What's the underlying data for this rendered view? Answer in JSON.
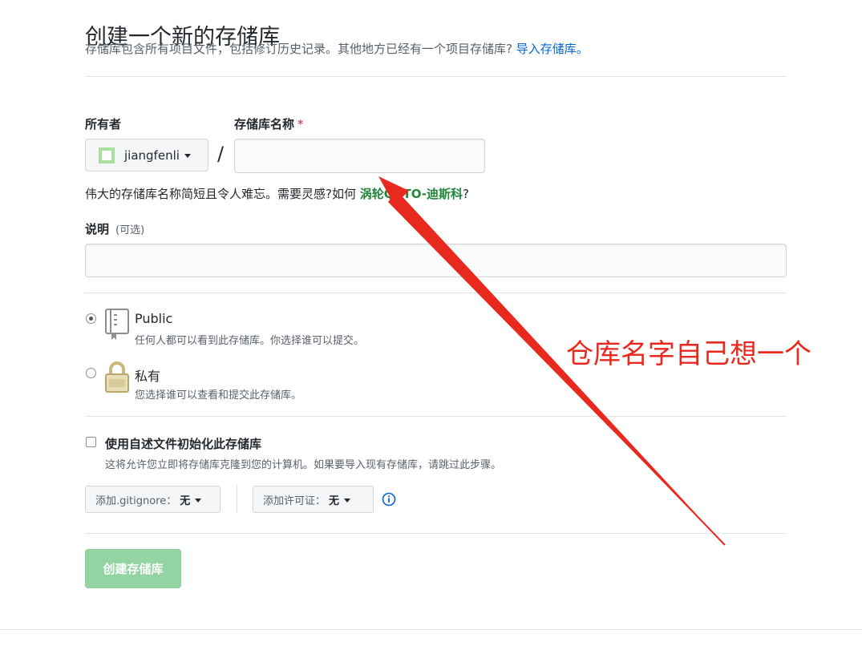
{
  "header": {
    "title": "创建一个新的存储库",
    "subtitle": "存储库包含所有项目文件，包括修订历史记录。其他地方已经有一个项目存储库?",
    "import_link": "导入存储库。"
  },
  "form": {
    "owner_label": "所有者",
    "owner_value": "jiangfenli",
    "slash": "/",
    "name_label": "存储库名称",
    "required_mark": "*",
    "name_value": "",
    "hint_prefix": "伟大的存储库名称简短且令人难忘。需要灵感?如何",
    "hint_suggestion": "涡轮OCTO-迪斯科",
    "hint_suffix": "?",
    "description_label": "说明",
    "description_optional": "(可选)",
    "description_value": ""
  },
  "visibility": {
    "public": {
      "title": "Public",
      "desc": "任何人都可以看到此存储库。你选择谁可以提交。",
      "checked": true
    },
    "private": {
      "title": "私有",
      "desc": "您选择谁可以查看和提交此存储库。",
      "checked": false
    }
  },
  "init": {
    "readme_label": "使用自述文件初始化此存储库",
    "readme_desc": "这将允许您立即将存储库克隆到您的计算机。如果要导入现有存储库，请跳过此步骤。",
    "readme_checked": false,
    "gitignore_label": "添加.gitignore：",
    "gitignore_value": "无",
    "license_label": "添加许可证：",
    "license_value": "无"
  },
  "submit": {
    "label": "创建存储库"
  },
  "annotation": {
    "text": "仓库名字自己想一个"
  },
  "colors": {
    "link": "#0366d6",
    "suggestion": "#22863a",
    "create_button": "#94d3a2",
    "annotation": "#e8291d",
    "required": "#cb2431"
  },
  "icons": {
    "public": "repo-book-icon",
    "private": "lock-icon",
    "info": "info-circle-icon",
    "annotation": "red-arrow"
  }
}
